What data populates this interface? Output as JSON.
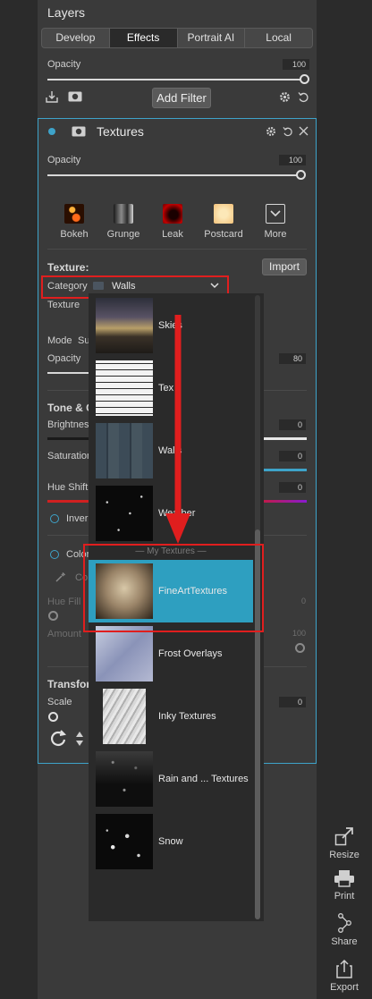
{
  "header": {
    "title": "Layers"
  },
  "tabs": [
    {
      "label": "Develop",
      "active": false
    },
    {
      "label": "Effects",
      "active": true
    },
    {
      "label": "Portrait AI",
      "active": false
    },
    {
      "label": "Local",
      "active": false
    }
  ],
  "layers": {
    "opacity_label": "Opacity",
    "opacity_value": "100",
    "add_filter_label": "Add Filter"
  },
  "filter": {
    "title": "Textures",
    "opacity_label": "Opacity",
    "opacity_value": "100",
    "effects": [
      {
        "label": "Bokeh"
      },
      {
        "label": "Grunge"
      },
      {
        "label": "Leak"
      },
      {
        "label": "Postcard"
      },
      {
        "label": "More"
      }
    ],
    "texture_label": "Texture:",
    "import_label": "Import",
    "category_label": "Category",
    "category_value": "Walls",
    "texture_row_label": "Texture",
    "mode_label": "Mode",
    "mode_value_partial": "Su",
    "opacity2_label": "Opacity",
    "opacity2_value": "80",
    "tone_section": "Tone & C",
    "brightness_label": "Brightnes",
    "brightness_value": "0",
    "saturation_label": "Saturation",
    "saturation_value": "0",
    "hue_shift_label": "Hue Shift",
    "hue_shift_value": "0",
    "invert_label": "Inver",
    "color_label": "Color",
    "color_picker_partial": "Co",
    "hue_fill_label": "Hue Fill",
    "hue_fill_value": "0",
    "amount_label": "Amount",
    "amount_value": "100",
    "transform_section": "Transfor",
    "scale_label": "Scale",
    "scale_value": "0"
  },
  "dropdown": {
    "section_label": "— My Textures —",
    "items": [
      {
        "name": "Skies",
        "selected": false
      },
      {
        "name": "Tex",
        "selected": false
      },
      {
        "name": "Walls",
        "selected": false
      },
      {
        "name": "Weather",
        "selected": false
      },
      {
        "name": "FineArtTextures",
        "selected": true
      },
      {
        "name": "Frost Overlays",
        "selected": false
      },
      {
        "name": "Inky Textures",
        "selected": false
      },
      {
        "name": "Rain and ... Textures",
        "selected": false
      },
      {
        "name": "Snow",
        "selected": false
      }
    ]
  },
  "right_toolbar": [
    {
      "label": "Resize",
      "icon": "resize-icon"
    },
    {
      "label": "Print",
      "icon": "printer-icon"
    },
    {
      "label": "Share",
      "icon": "share-icon"
    },
    {
      "label": "Export",
      "icon": "export-icon"
    }
  ],
  "colors": {
    "accent": "#3ea3c9",
    "selected_row": "#2e9fc0",
    "annotation_red": "#e01e1e",
    "panel_bg": "#3a3a3a",
    "app_bg": "#2b2b2b"
  }
}
